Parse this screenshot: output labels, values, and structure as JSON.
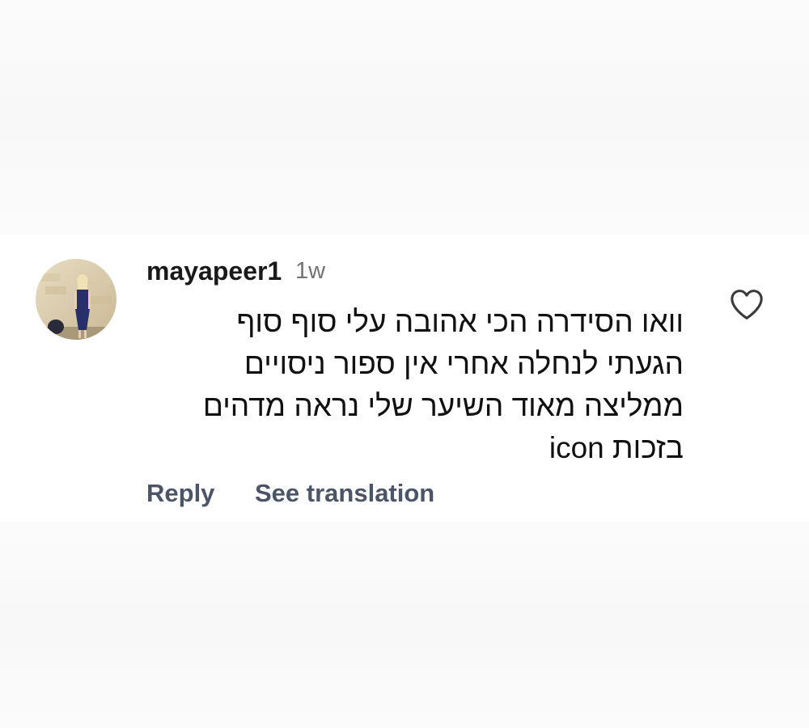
{
  "comment": {
    "username": "mayapeer1",
    "time": "1w",
    "lines": [
      "וואו הסידרה הכי אהובה עלי סוף סוף",
      "הגעתי לנחלה אחרי אין ספור ניסויים",
      "ממליצה מאוד השיער שלי נראה מדהים",
      "בזכות icon"
    ],
    "like_icon": "heart-outline-icon",
    "actions": {
      "reply": "Reply",
      "see_translation": "See translation"
    }
  }
}
